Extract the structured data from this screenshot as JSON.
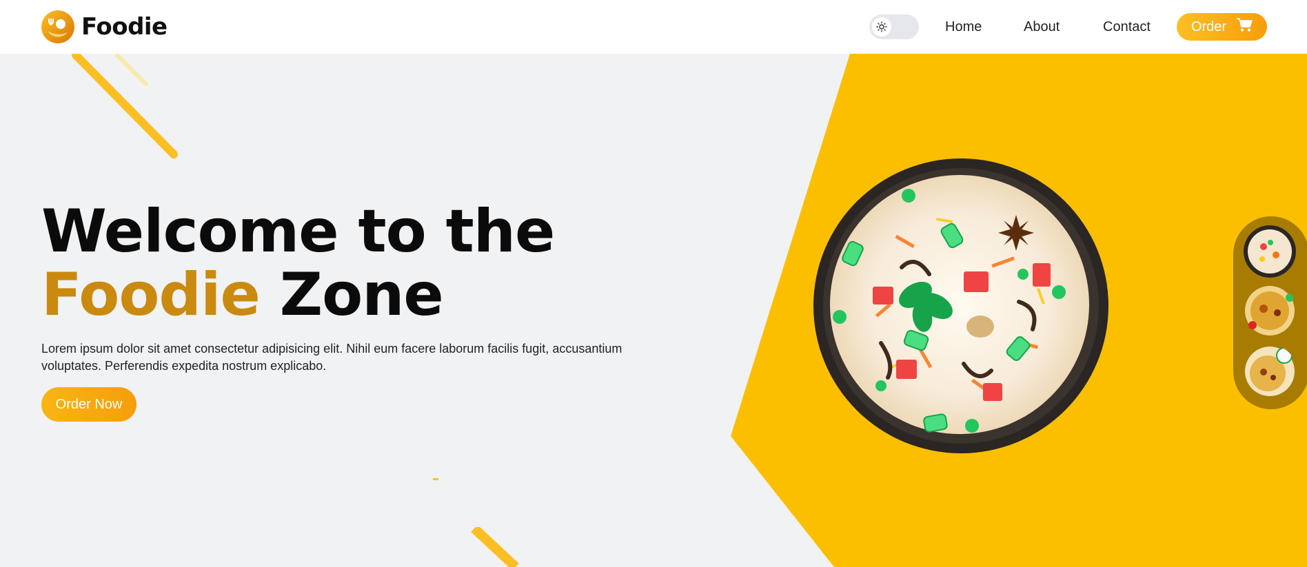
{
  "brand": {
    "name": "Foodie",
    "logo_icon": "utensils-icon"
  },
  "nav": {
    "theme_toggle_icon": "sun-icon",
    "links": [
      {
        "label": "Home"
      },
      {
        "label": "About"
      },
      {
        "label": "Contact"
      }
    ],
    "order_button": {
      "label": "Order",
      "icon": "cart-icon"
    }
  },
  "hero": {
    "title_line1": "Welcome to the",
    "title_accent": "Foodie",
    "title_rest": "Zone",
    "description": "Lorem ipsum dolor sit amet consectetur adipisicing elit. Nihil eum facere laborum facilis fugit, accusantium voluptates. Perferendis expedita nostrum explicabo.",
    "cta_label": "Order Now"
  },
  "colors": {
    "accent_yellow": "#fbbf00",
    "accent_text": "#c98a0f",
    "rail": "#a77c00",
    "page_bg": "#f1f2f4"
  }
}
